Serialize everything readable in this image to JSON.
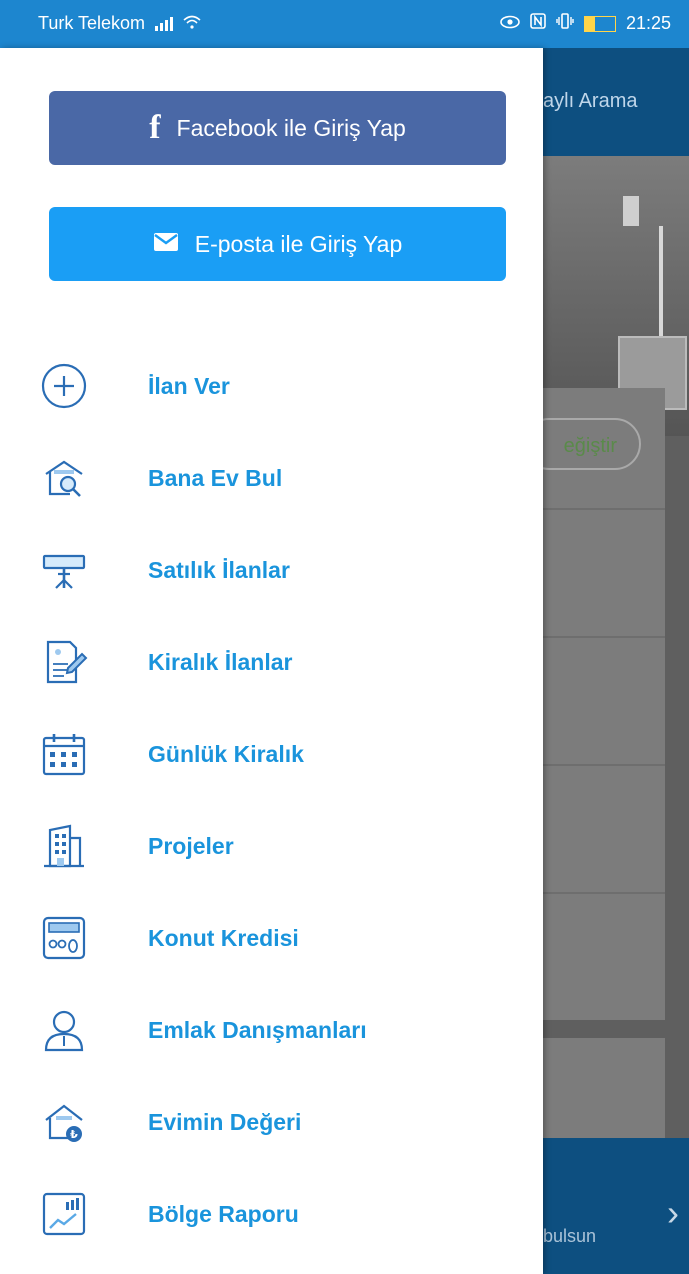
{
  "status_bar": {
    "carrier": "Turk Telekom",
    "time": "21:25",
    "battery": "14"
  },
  "background_app": {
    "header_text": "aylı Arama",
    "pill_text": "eğiştir",
    "bottom_text": "bulsun"
  },
  "drawer": {
    "facebook_button": "Facebook ile Giriş Yap",
    "email_button": "E-posta ile Giriş Yap",
    "menu": [
      {
        "label": "İlan Ver",
        "icon": "plus-circle-icon"
      },
      {
        "label": "Bana Ev Bul",
        "icon": "house-search-icon"
      },
      {
        "label": "Satılık İlanlar",
        "icon": "signpost-icon"
      },
      {
        "label": "Kiralık İlanlar",
        "icon": "document-edit-icon"
      },
      {
        "label": "Günlük Kiralık",
        "icon": "calendar-icon"
      },
      {
        "label": "Projeler",
        "icon": "building-icon"
      },
      {
        "label": "Konut Kredisi",
        "icon": "calculator-icon"
      },
      {
        "label": "Emlak Danışmanları",
        "icon": "person-icon"
      },
      {
        "label": "Evimin Değeri",
        "icon": "house-value-icon"
      },
      {
        "label": "Bölge Raporu",
        "icon": "report-chart-icon"
      }
    ]
  },
  "colors": {
    "accent": "#1a94dc",
    "facebook": "#4a68a6",
    "email": "#1a9ef5",
    "status_bar": "#1d86cf"
  }
}
